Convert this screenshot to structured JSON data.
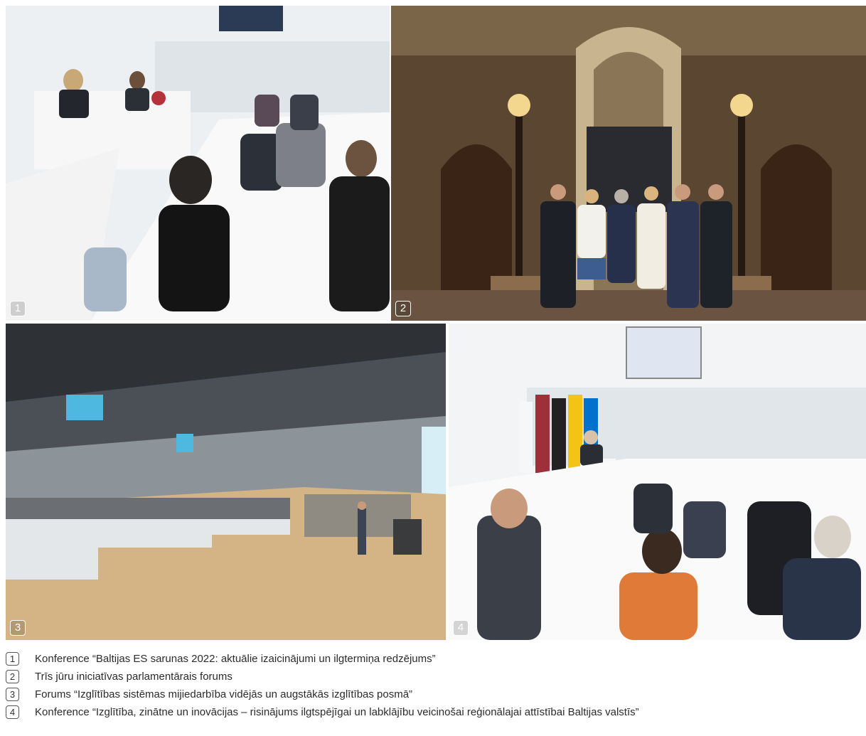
{
  "photos": [
    {
      "number": "1",
      "colors": {
        "wall": "#f4f6f7",
        "seat": "#ffffff",
        "suit": "#2b2f36"
      }
    },
    {
      "number": "2",
      "colors": {
        "wall": "#6e5a3e",
        "door": "#3a2416",
        "gold": "#c9a86a"
      }
    },
    {
      "number": "3",
      "colors": {
        "ceiling": "#2e3136",
        "floor": "#d4b384",
        "screen": "#4fb8e0"
      }
    },
    {
      "number": "4",
      "colors": {
        "wall": "#f2f4f5",
        "flag_lv": "#9e3039",
        "flag_lt": "#f3c316",
        "flag_ee": "#0072ce"
      }
    }
  ],
  "captions": [
    {
      "number": "1",
      "text": "Konference “Baltijas ES sarunas 2022: aktuālie izaicinājumi un ilgtermiņa redzējums”"
    },
    {
      "number": "2",
      "text": "Trīs jūru iniciatīvas parlamentārais forums"
    },
    {
      "number": "3",
      "text": "Forums “Izglītības sistēmas mijiedarbība vidējās un augstākās izglītības posmā”"
    },
    {
      "number": "4",
      "text": "Konference “Izglītība, zinātne un inovācijas – risinājums ilgtspējīgai un labklājību veicinošai reģionālajai attīstībai Baltijas valstīs”"
    }
  ]
}
